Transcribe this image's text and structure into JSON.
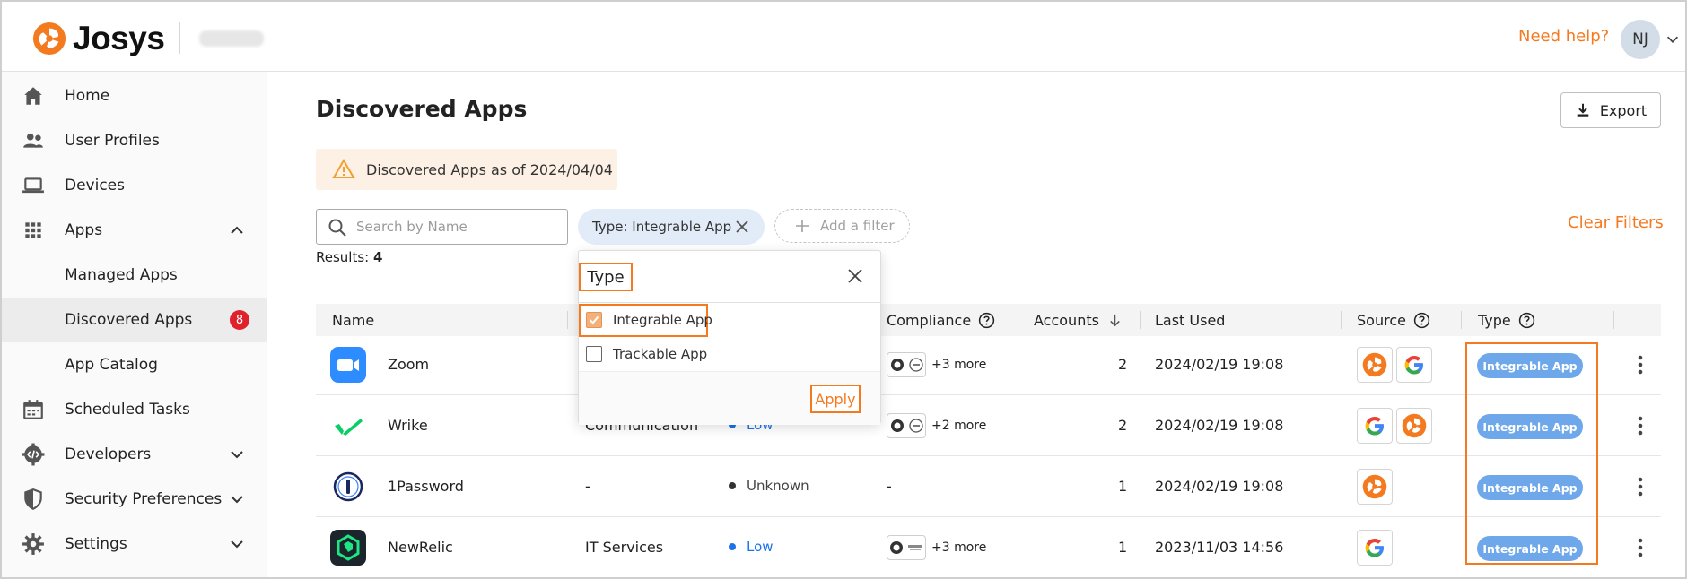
{
  "header": {
    "brand": "Josys",
    "help": "Need help?",
    "avatar_initials": "NJ"
  },
  "sidebar": {
    "items": [
      {
        "label": "Home",
        "icon": "home-icon"
      },
      {
        "label": "User Profiles",
        "icon": "users-icon"
      },
      {
        "label": "Devices",
        "icon": "laptop-icon"
      },
      {
        "label": "Apps",
        "icon": "grid-icon",
        "expanded": true
      },
      {
        "label": "Managed Apps"
      },
      {
        "label": "Discovered Apps",
        "badge": "8",
        "active": true
      },
      {
        "label": "App Catalog"
      },
      {
        "label": "Scheduled Tasks",
        "icon": "calendar-icon"
      },
      {
        "label": "Developers",
        "icon": "developer-gear-icon"
      },
      {
        "label": "Security Preferences",
        "icon": "shield-icon"
      },
      {
        "label": "Settings",
        "icon": "gear-icon"
      }
    ]
  },
  "main": {
    "title": "Discovered Apps",
    "export_label": "Export",
    "notice": "Discovered Apps as of 2024/04/04",
    "search_placeholder": "Search by Name",
    "filter_chip": "Type: Integrable App",
    "add_filter": "Add a filter",
    "clear_filters": "Clear Filters",
    "results_label": "Results:",
    "results_count": "4"
  },
  "table": {
    "headers": {
      "name": "Name",
      "compliance": "Compliance",
      "accounts": "Accounts",
      "last_used": "Last Used",
      "source": "Source",
      "type": "Type"
    },
    "rows": [
      {
        "name": "Zoom",
        "category": "",
        "risk": "",
        "compliance_more": "+3 more",
        "accounts": "2",
        "last_used": "2024/02/19 19:08",
        "type": "Integrable App"
      },
      {
        "name": "Wrike",
        "category": "Communication",
        "risk": "Low",
        "compliance_more": "+2 more",
        "accounts": "2",
        "last_used": "2024/02/19 19:08",
        "type": "Integrable App"
      },
      {
        "name": "1Password",
        "category": "-",
        "risk": "Unknown",
        "compliance_more": "-",
        "accounts": "1",
        "last_used": "2024/02/19 19:08",
        "type": "Integrable App"
      },
      {
        "name": "NewRelic",
        "category": "IT Services",
        "risk": "Low",
        "compliance_more": "+3 more",
        "accounts": "1",
        "last_used": "2023/11/03 14:56",
        "type": "Integrable App"
      }
    ]
  },
  "popover": {
    "title": "Type",
    "options": [
      {
        "label": "Integrable App",
        "checked": true
      },
      {
        "label": "Trackable App",
        "checked": false
      }
    ],
    "apply": "Apply"
  },
  "colors": {
    "accent": "#f47a20",
    "chip_bg": "#e1ecf8",
    "type_pill": "#6fa8ea",
    "risk_low": "#1a73e8",
    "badge_red": "#e0202a"
  }
}
